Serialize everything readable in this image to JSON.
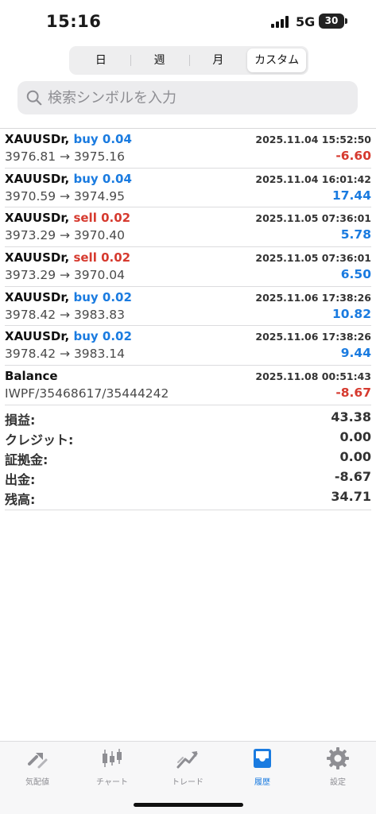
{
  "status": {
    "time": "15:16",
    "network": "5G",
    "battery": "30"
  },
  "period_tabs": [
    {
      "label": "日",
      "active": false
    },
    {
      "label": "週",
      "active": false
    },
    {
      "label": "月",
      "active": false
    },
    {
      "label": "カスタム",
      "active": true
    }
  ],
  "search": {
    "placeholder": "検索シンボルを入力"
  },
  "deals": [
    {
      "symbol": "XAUUSDr,",
      "side": "buy",
      "volume": "0.04",
      "time": "2025.11.04 15:52:50",
      "prices": "3976.81 → 3975.16",
      "profit": "-6.60"
    },
    {
      "symbol": "XAUUSDr,",
      "side": "buy",
      "volume": "0.04",
      "time": "2025.11.04 16:01:42",
      "prices": "3970.59 → 3974.95",
      "profit": "17.44"
    },
    {
      "symbol": "XAUUSDr,",
      "side": "sell",
      "volume": "0.02",
      "time": "2025.11.05 07:36:01",
      "prices": "3973.29 → 3970.40",
      "profit": "5.78"
    },
    {
      "symbol": "XAUUSDr,",
      "side": "sell",
      "volume": "0.02",
      "time": "2025.11.05 07:36:01",
      "prices": "3973.29 → 3970.04",
      "profit": "6.50"
    },
    {
      "symbol": "XAUUSDr,",
      "side": "buy",
      "volume": "0.02",
      "time": "2025.11.06 17:38:26",
      "prices": "3978.42 → 3983.83",
      "profit": "10.82"
    },
    {
      "symbol": "XAUUSDr,",
      "side": "buy",
      "volume": "0.02",
      "time": "2025.11.06 17:38:26",
      "prices": "3978.42 → 3983.14",
      "profit": "9.44"
    },
    {
      "symbol": "Balance",
      "side": "",
      "volume": "",
      "time": "2025.11.08 00:51:43",
      "prices": "IWPF/35468617/35444242",
      "profit": "-8.67"
    }
  ],
  "summary": [
    {
      "label": "損益:",
      "value": "43.38"
    },
    {
      "label": "クレジット:",
      "value": "0.00"
    },
    {
      "label": "証拠金:",
      "value": "0.00"
    },
    {
      "label": "出金:",
      "value": "-8.67"
    },
    {
      "label": "残高:",
      "value": "34.71"
    }
  ],
  "bottom_tabs": [
    {
      "label": "気配値",
      "icon": "quotes-icon",
      "active": false
    },
    {
      "label": "チャート",
      "icon": "chart-candles-icon",
      "active": false
    },
    {
      "label": "トレード",
      "icon": "trade-icon",
      "active": false
    },
    {
      "label": "履歴",
      "icon": "history-inbox-icon",
      "active": true
    },
    {
      "label": "設定",
      "icon": "gear-icon",
      "active": false
    }
  ],
  "colors": {
    "accent": "#1a7be0",
    "loss": "#d63a2f",
    "muted": "#8e8e93"
  }
}
